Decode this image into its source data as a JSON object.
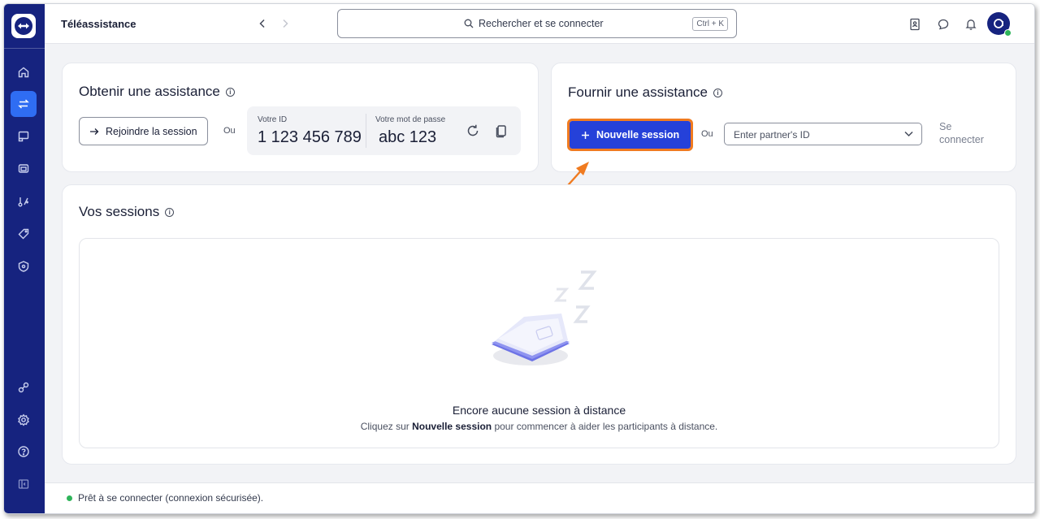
{
  "topbar": {
    "title": "Téléassistance",
    "search_placeholder": "Rechercher et se connecter",
    "search_shortcut": "Ctrl + K"
  },
  "get_support": {
    "title": "Obtenir une assistance",
    "join_label": "Rejoindre la session",
    "or_label": "Ou",
    "id_label": "Votre ID",
    "id_value": "1 123 456 789",
    "password_label": "Votre mot de passe",
    "password_value": "abc 123"
  },
  "provide_support": {
    "title": "Fournir une assistance",
    "new_session_label": "Nouvelle session",
    "or_label": "Ou",
    "partner_placeholder": "Enter partner's ID",
    "connect_label_line1": "Se",
    "connect_label_line2": "connecter"
  },
  "sessions": {
    "title": "Vos sessions",
    "empty_title": "Encore aucune session à distance",
    "empty_desc_prefix": "Cliquez sur ",
    "empty_desc_bold": "Nouvelle session",
    "empty_desc_suffix": " pour commencer à aider les participants à distance."
  },
  "status": {
    "text": "Prêt à se connecter (connexion sécurisée)."
  },
  "colors": {
    "sidebar": "#16237f",
    "active": "#2f6df3",
    "primary": "#2541d9",
    "highlight": "#f07b20",
    "online": "#2fb45a"
  },
  "sidebar_icons": [
    "home-icon",
    "remote-control-icon",
    "devices-icon",
    "screen-icon",
    "workflows-icon",
    "tag-icon",
    "security-icon",
    "connections-icon",
    "settings-icon",
    "help-icon",
    "collapse-icon"
  ]
}
